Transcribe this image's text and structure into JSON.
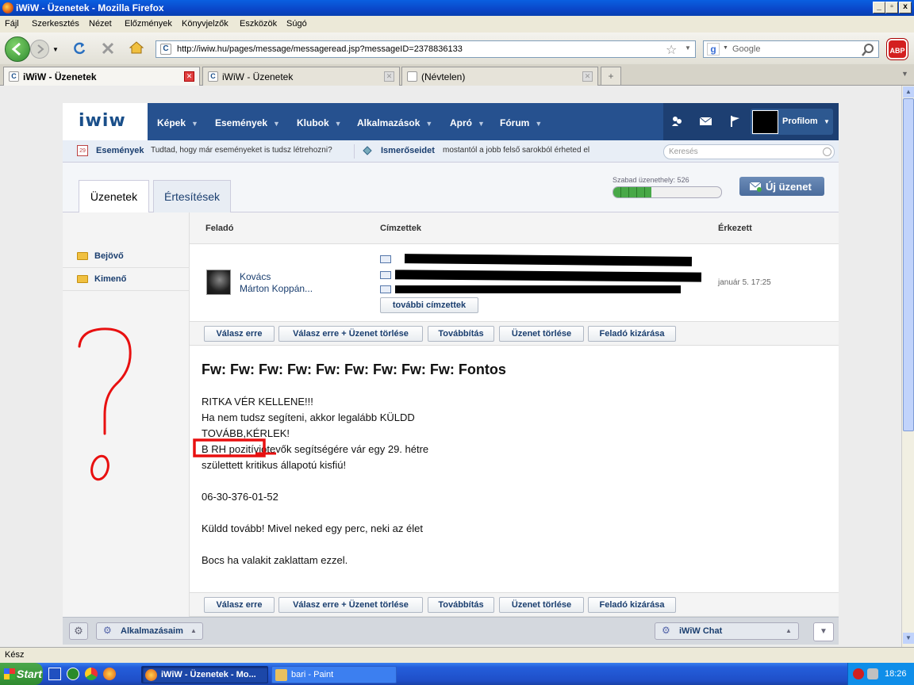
{
  "window": {
    "title": "iWiW - Üzenetek - Mozilla Firefox",
    "buttons": [
      "_",
      "▫",
      "x"
    ]
  },
  "menu": [
    "Fájl",
    "Szerkesztés",
    "Nézet",
    "Előzmények",
    "Könyvjelzők",
    "Eszközök",
    "Súgó"
  ],
  "navbar": {
    "url": "http://iwiw.hu/pages/message/messageread.jsp?messageID=2378836133",
    "search_placeholder": "Google",
    "abp": "ABP"
  },
  "tabs": [
    {
      "label": "iWiW - Üzenetek",
      "active": true
    },
    {
      "label": "iWiW - Üzenetek",
      "active": false
    },
    {
      "label": "(Névtelen)",
      "active": false
    }
  ],
  "site": {
    "logo": "iwiw",
    "nav": [
      "Képek",
      "Események",
      "Klubok",
      "Alkalmazások",
      "Apró",
      "Fórum"
    ],
    "profile": "Profilom",
    "info": {
      "events_label": "Események",
      "events_text": "Tudtad, hogy már eseményeket is tudsz létrehozni?",
      "friends_label": "Ismerőseidet",
      "friends_text": "mostantól a jobb felső sarokból érheted el",
      "date_icon": "29"
    },
    "search_placeholder": "Keresés",
    "tabs": [
      "Üzenetek",
      "Értesítések"
    ],
    "free_slots": "Szabad üzenethely: 526",
    "free_slots_fill": 0.35,
    "new_message": "Új üzenet",
    "folders": [
      "Bejövő",
      "Kimenő"
    ],
    "columns": {
      "from": "Feladó",
      "to": "Címzettek",
      "arrived": "Érkezett"
    },
    "message": {
      "sender_first": "Kovács",
      "sender_last": "Márton Koppán...",
      "more_recipients": "további címzettek",
      "date": "január 5. 17:25",
      "subject": "Fw: Fw: Fw: Fw: Fw: Fw: Fw: Fw: Fw: Fontos",
      "body": [
        "RITKA VÉR KELLENE!!!",
        "Ha nem tudsz segíteni, akkor legalább KÜLDD",
        "TOVÁBB,KÉRLEK!",
        "B RH pozitív",
        "születtett kritikus állapotú kisfiú!",
        "06-30-376-01-52",
        "Küldd tovább! Mivel neked egy perc, neki az élet",
        "Bocs ha valakit zaklattam ezzel."
      ],
      "body_line4_rest": "jótevők segítségére vár egy 29. hétre"
    },
    "actions": [
      "Válasz erre",
      "Válasz erre + Üzenet törlése",
      "Továbbítás",
      "Üzenet törlése",
      "Feladó kizárása"
    ],
    "apps_label": "Alkalmazásaim",
    "chat_label": "iWiW Chat"
  },
  "status": "Kész",
  "taskbar": {
    "start": "Start",
    "tasks": [
      "iWiW - Üzenetek - Mo...",
      "bari - Paint"
    ],
    "clock": "18:26"
  },
  "annotation": {
    "color": "#e81010",
    "mark": "?"
  }
}
